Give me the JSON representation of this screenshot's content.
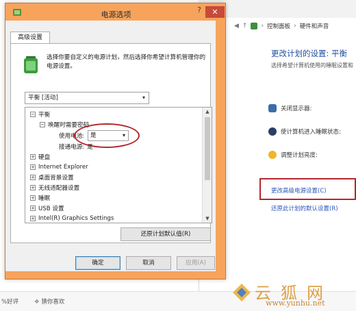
{
  "dialog": {
    "title": "电源选项",
    "help_glyph": "?",
    "close_glyph": "✕",
    "tab_label": "高级设置",
    "description": "选择你要自定义的电源计划，然后选择你希望计算机管理你的电源设置。",
    "plan_select_value": "平衡 [活动]",
    "tree": {
      "root_label": "平衡",
      "group_label": "唤醒时需要密码",
      "battery_label": "使用电池:",
      "battery_value": "是",
      "plugged_label": "接通电源:",
      "plugged_value": "是",
      "items": [
        "硬盘",
        "Internet Explorer",
        "桌面背景设置",
        "无线适配器设置",
        "睡眠",
        "USB 设置",
        "Intel(R) Graphics Settings"
      ]
    },
    "restore_defaults_label": "还原计划默认值(R)",
    "ok_label": "确定",
    "cancel_label": "取消",
    "apply_label": "应用(A)"
  },
  "background": {
    "help_glyph": "?",
    "breadcrumb": [
      "控制面板",
      "硬件和声音"
    ],
    "heading": "更改计划的设置: 平衡",
    "subheading": "选择希望计算机使用的睡眠设置和",
    "items": [
      "关闭显示器:",
      "使计算机进入睡眠状态:",
      "调整计划亮度:"
    ],
    "advanced_link": "更改高级电源设置(C)",
    "restore_link": "还原此计划的默认设置(R)",
    "bottom_left": "%好评",
    "bottom_right": "猜你喜欢"
  },
  "watermark": {
    "name": "云狐网",
    "url": "www.yunhu.net"
  },
  "colors": {
    "dialog_frame": "#f7a35c",
    "close_button": "#c74a3a",
    "highlight": "#b3262b",
    "link": "#2a56b8"
  }
}
